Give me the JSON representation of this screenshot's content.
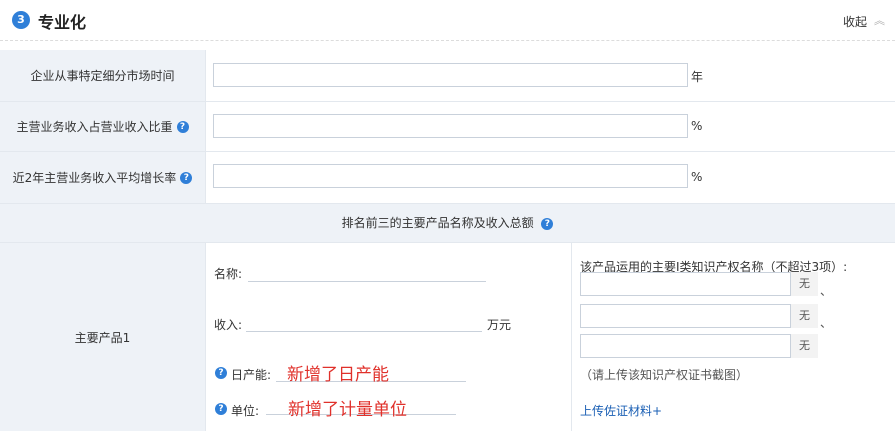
{
  "section": {
    "step": "3",
    "title": "专业化",
    "collapse_label": "收起"
  },
  "rows": [
    {
      "label": "企业从事特定细分市场时间",
      "value": "",
      "unit": "年",
      "help": false
    },
    {
      "label": "主营业务收入占营业收入比重",
      "value": "",
      "unit": "%",
      "help": true
    },
    {
      "label": "近2年主营业务收入平均增长率",
      "value": "",
      "unit": "%",
      "help": true
    }
  ],
  "top_products_header": "排名前三的主要产品名称及收入总额",
  "product1": {
    "label": "主要产品1",
    "name_label": "名称:",
    "income_label": "收入:",
    "income_unit": "万元",
    "daily_capacity_label": "日产能:",
    "daily_capacity_note": "新增了日产能",
    "unit_label": "单位:",
    "unit_note": "新增了计量单位",
    "ip_header": "该产品运用的主要Ⅰ类知识产权名称（不超过3项）:",
    "ip_button": "无",
    "ip_separator": "、",
    "ip_hint": "（请上传该知识产权证书截图）",
    "upload_link": "上传佐证材料+"
  },
  "colors": {
    "accent": "#2f7fd8",
    "label_bg": "#eef2f7",
    "note_red": "#e0312b",
    "link": "#1a5fb4"
  }
}
